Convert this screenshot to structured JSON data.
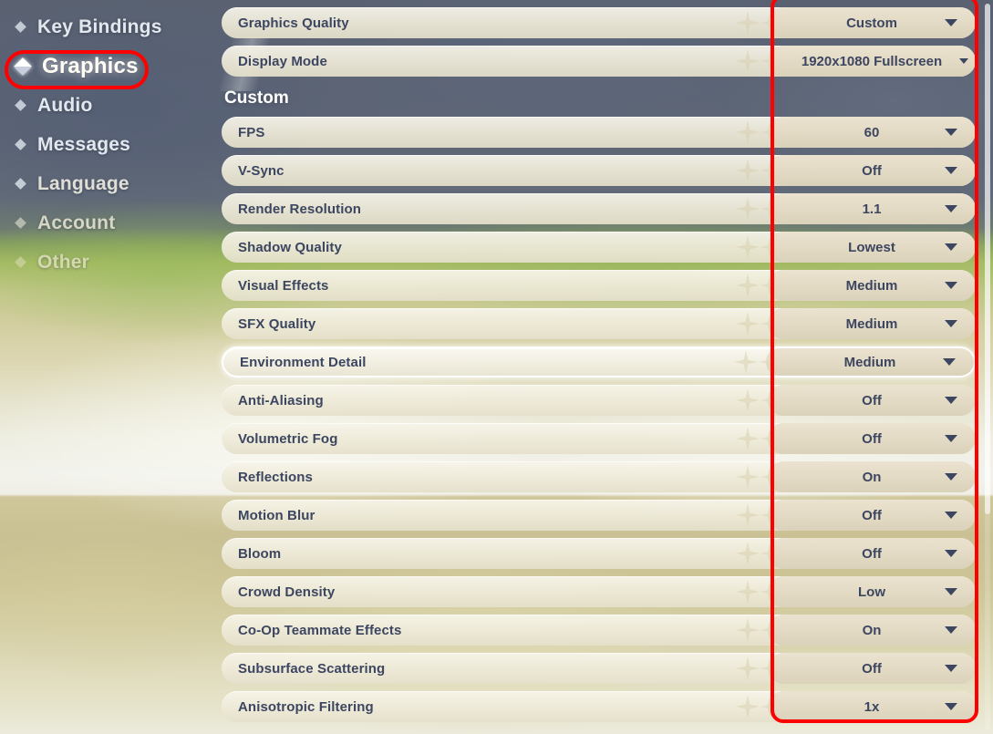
{
  "sidebar": {
    "items": [
      {
        "label": "Key Bindings",
        "state": "normal"
      },
      {
        "label": "Graphics",
        "state": "active"
      },
      {
        "label": "Audio",
        "state": "normal"
      },
      {
        "label": "Messages",
        "state": "normal"
      },
      {
        "label": "Language",
        "state": "dim1"
      },
      {
        "label": "Account",
        "state": "dim2"
      },
      {
        "label": "Other",
        "state": "dim3"
      }
    ]
  },
  "settings": {
    "section_header": "Custom",
    "top_rows": [
      {
        "label": "Graphics Quality",
        "value": "Custom"
      },
      {
        "label": "Display Mode",
        "value": "1920x1080 Fullscreen"
      }
    ],
    "custom_rows": [
      {
        "label": "FPS",
        "value": "60"
      },
      {
        "label": "V-Sync",
        "value": "Off"
      },
      {
        "label": "Render Resolution",
        "value": "1.1"
      },
      {
        "label": "Shadow Quality",
        "value": "Lowest"
      },
      {
        "label": "Visual Effects",
        "value": "Medium"
      },
      {
        "label": "SFX Quality",
        "value": "Medium"
      },
      {
        "label": "Environment Detail",
        "value": "Medium"
      },
      {
        "label": "Anti-Aliasing",
        "value": "Off"
      },
      {
        "label": "Volumetric Fog",
        "value": "Off"
      },
      {
        "label": "Reflections",
        "value": "On"
      },
      {
        "label": "Motion Blur",
        "value": "Off"
      },
      {
        "label": "Bloom",
        "value": "Off"
      },
      {
        "label": "Crowd Density",
        "value": "Low"
      },
      {
        "label": "Co-Op Teammate Effects",
        "value": "On"
      },
      {
        "label": "Subsurface Scattering",
        "value": "Off"
      },
      {
        "label": "Anisotropic Filtering",
        "value": "1x"
      }
    ],
    "focused_row_label": "Environment Detail"
  },
  "icons": {
    "dropdown_caret": "chevron-down-icon",
    "sparkle": "sparkle-icon",
    "nav_bullet": "diamond-bullet-icon"
  },
  "annotations": {
    "colors": {
      "highlight": "#fe0000"
    },
    "boxes": [
      {
        "name": "graphics-nav-highlight",
        "target": "Graphics"
      },
      {
        "name": "value-column-highlight",
        "target": "settings value column"
      }
    ]
  },
  "colors": {
    "row_background": "#efecd9",
    "value_background": "#e6ddc5",
    "label_text": "#3d4660",
    "section_header_text": "#ffffff",
    "nav_text": "#e3e8ee"
  }
}
